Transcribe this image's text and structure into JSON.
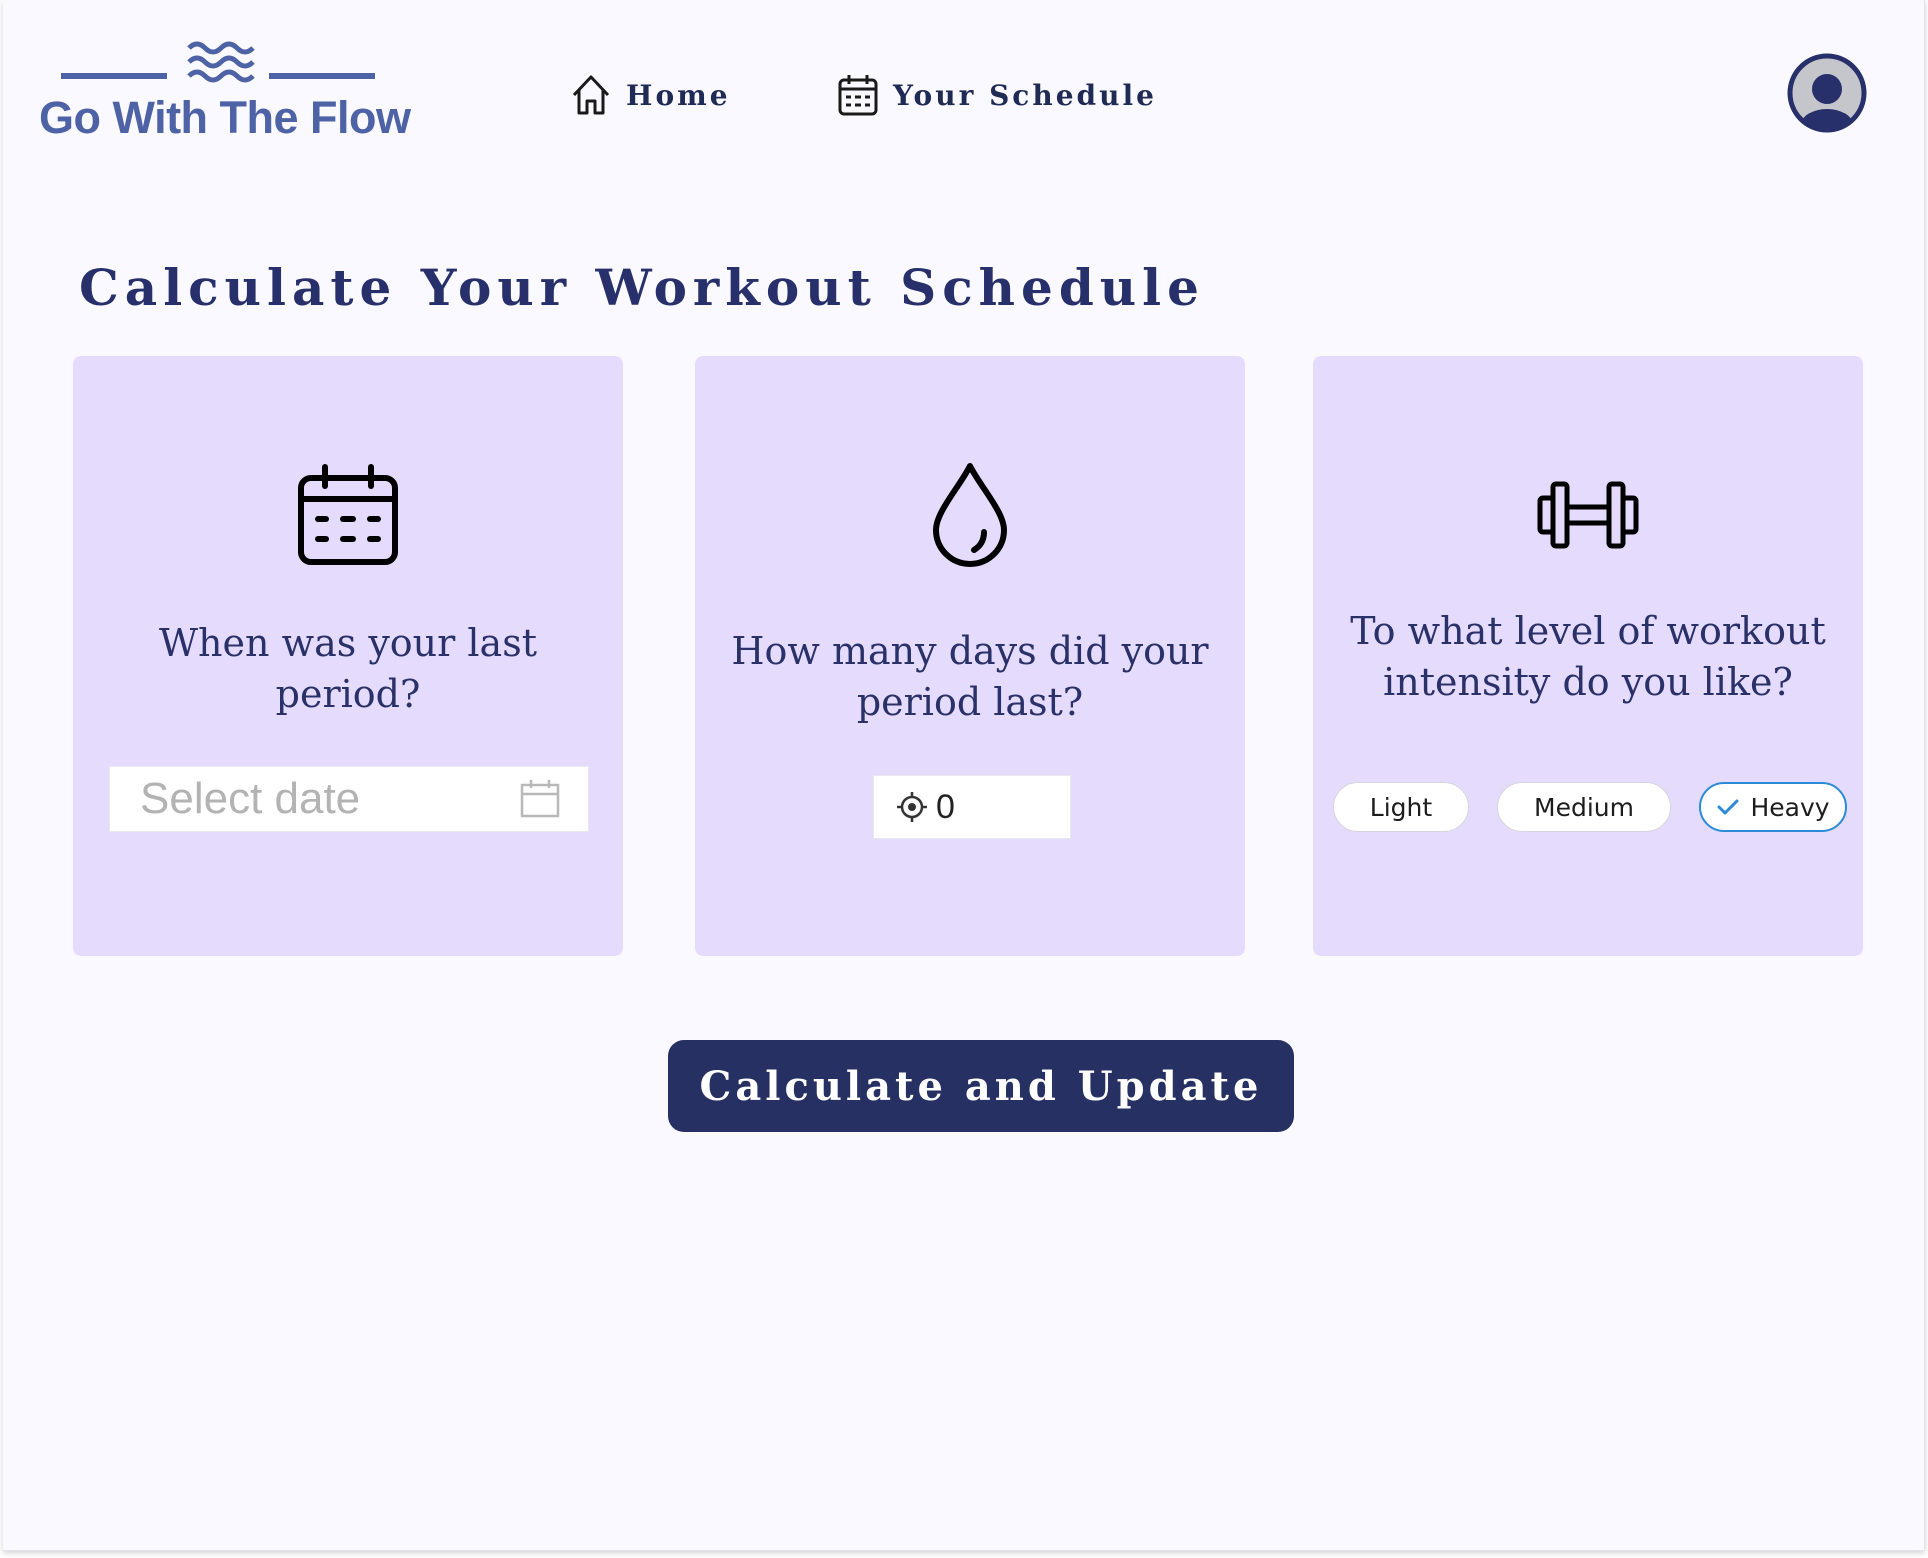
{
  "app": {
    "name": "Go With The Flow"
  },
  "nav": {
    "home_label": "Home",
    "schedule_label": "Your Schedule"
  },
  "main": {
    "title": "Calculate Your Workout Schedule",
    "cards": [
      {
        "icon": "calendar-icon",
        "question": "When was your last period?",
        "input_placeholder": "Select date"
      },
      {
        "icon": "water-drop-icon",
        "question": "How many days did your period last?",
        "input_value": "0"
      },
      {
        "icon": "dumbbell-icon",
        "question": "To what level of workout intensity do you like?",
        "options": [
          "Light",
          "Medium",
          "Heavy"
        ],
        "selected": "Heavy"
      }
    ],
    "submit_label": "Calculate and Update"
  },
  "colors": {
    "brand": "#4e63a6",
    "navy": "#263063",
    "card_bg": "#e4dbfd",
    "page_bg": "#f9f9ff",
    "selected_border": "#2b8bd8"
  }
}
